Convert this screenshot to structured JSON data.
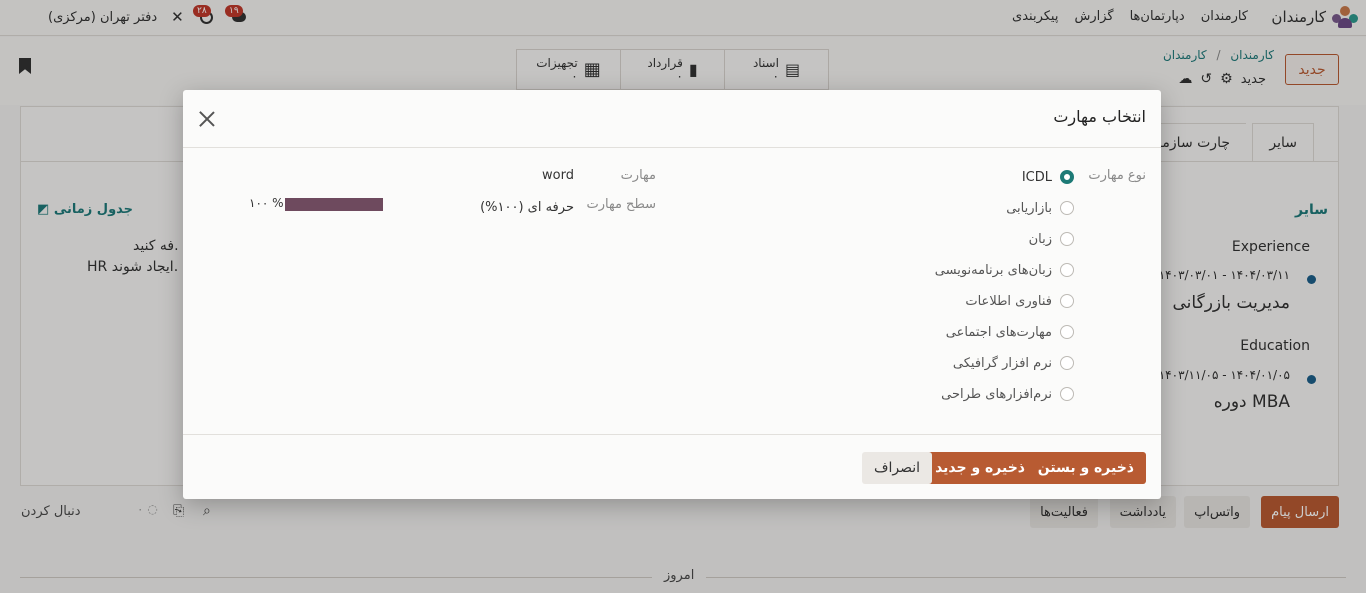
{
  "topbar": {
    "app_name": "کارمندان",
    "menu": [
      "کارمندان",
      "دپارتمان‌ها",
      "گزارش",
      "پیکربندی"
    ],
    "company": "دفتر تهران (مرکزی)",
    "activity_count": "۲۸",
    "message_count": "۱۹"
  },
  "control": {
    "new_button": "جدید",
    "breadcrumb_parent": "کارمندان",
    "breadcrumb_sep": "/",
    "breadcrumb_current": "کارمندان",
    "record_name": "جدید",
    "smart_buttons": [
      {
        "label": "اسناد",
        "count": "۰"
      },
      {
        "label": "قرارداد",
        "count": "۰"
      },
      {
        "label": "تجهیزات",
        "count": "۰"
      }
    ]
  },
  "sheet": {
    "tabs": [
      "سایر",
      "چارت سازمانی"
    ],
    "section_title": "سایر",
    "timeline_link": "جدول زمانی",
    "hint_line1": "فه کنید.",
    "hint_line2": "HR ایجاد شوند.",
    "resume": [
      {
        "group": "Experience",
        "dates": "۱۴۰۳/۰۳/۰۱ - ۱۴۰۴/۰۳/۱۱",
        "title": "مدیریت بازرگانی"
      },
      {
        "group": "Education",
        "dates": "۱۴۰۳/۱۱/۰۵ - ۱۴۰۴/۰۱/۰۵",
        "title": "دوره MBA"
      }
    ]
  },
  "chatter": {
    "send_message": "ارسال پیام",
    "whatsapp": "واتس‌اپ",
    "log_note": "یادداشت",
    "activities": "فعالیت‌ها",
    "follow": "دنبال کردن",
    "followers_count": "۰",
    "today": "امروز"
  },
  "modal": {
    "title": "انتخاب مهارت",
    "skill_type_label": "نوع مهارت",
    "skill_types": [
      {
        "label": "ICDL",
        "selected": true
      },
      {
        "label": "بازاریابی",
        "selected": false
      },
      {
        "label": "زبان",
        "selected": false
      },
      {
        "label": "زبان‌های برنامه‌نویسی",
        "selected": false
      },
      {
        "label": "فناوری اطلاعات",
        "selected": false
      },
      {
        "label": "مهارت‌های اجتماعی",
        "selected": false
      },
      {
        "label": "نرم افزار گرافیکی",
        "selected": false
      },
      {
        "label": "نرم‌افزارهای طراحی",
        "selected": false
      }
    ],
    "skill_label": "مهارت",
    "skill_value": "word",
    "level_label": "سطح مهارت",
    "level_value": "حرفه ای (۱۰۰%)",
    "progress_text": "۱۰۰ %",
    "progress_fraction": 1.0,
    "save_close": "ذخیره و بستن",
    "save_new": "ذخیره و جدید",
    "discard": "انصراف"
  },
  "colors": {
    "primary": "#b85b32",
    "radio_selected": "#1d7a76",
    "progress_fill": "#6e4a5e"
  }
}
